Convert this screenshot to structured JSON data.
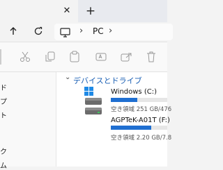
{
  "tabs": {
    "close_glyph": "✕",
    "new_tab_glyph": "+"
  },
  "address": {
    "location": "PC",
    "chevron": "›"
  },
  "sidebar": {
    "items": [
      "ド",
      "プ",
      "ト",
      "",
      "",
      "",
      "ク",
      "ム"
    ]
  },
  "group": {
    "title": "デバイスとドライブ",
    "chevron": "⌄"
  },
  "drives": [
    {
      "name": "Windows (C:)",
      "space": "空き領域 251 GB/476",
      "used_fraction": 0.47,
      "icon": "windows-drive-icon"
    },
    {
      "name": "AGPTeK-A01T (F:)",
      "space": "空き領域 2.20 GB/7.8",
      "used_fraction": 0.72,
      "icon": "removable-drive-icon"
    }
  ],
  "colors": {
    "accent": "#1f6fd1",
    "link": "#1a5fb4"
  }
}
